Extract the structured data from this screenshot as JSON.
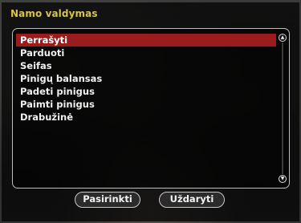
{
  "dialog": {
    "title": "Namo valdymas",
    "items": [
      {
        "label": "Perrašyti",
        "selected": true
      },
      {
        "label": "Parduoti",
        "selected": false
      },
      {
        "label": "Seifas",
        "selected": false
      },
      {
        "label": "Pinigų balansas",
        "selected": false
      },
      {
        "label": "Padeti pinigus",
        "selected": false
      },
      {
        "label": "Paimti pinigus",
        "selected": false
      },
      {
        "label": "Drabužinė",
        "selected": false
      }
    ],
    "scroll_up_glyph": "▲",
    "scroll_down_glyph": "▼",
    "buttons": {
      "select_label": "Pasirinkti",
      "close_label": "Uždaryti"
    }
  },
  "colors": {
    "title": "#d7c44a",
    "selection": "#9a1c1c"
  }
}
